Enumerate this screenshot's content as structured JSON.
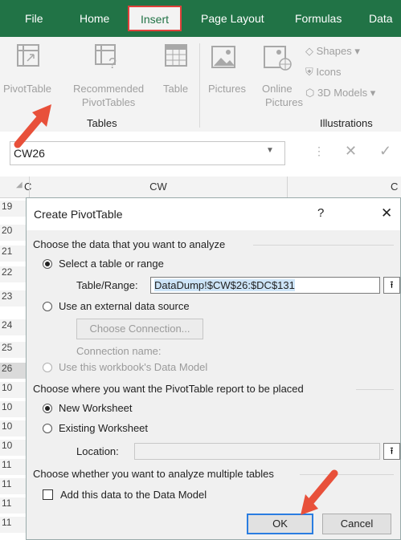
{
  "ribbon_tabs": [
    "File",
    "Home",
    "Insert",
    "Page Layout",
    "Formulas",
    "Data"
  ],
  "ribbon": {
    "pivottable": "PivotTable",
    "recommended_line1": "Recommended",
    "recommended_line2": "PivotTables",
    "table": "Table",
    "pictures": "Pictures",
    "online_line1": "Online",
    "online_line2": "Pictures",
    "shapes": "Shapes",
    "icons": "Icons",
    "models": "3D Models",
    "group_tables": "Tables",
    "group_illustrations": "Illustrations"
  },
  "namebox": "CW26",
  "grid": {
    "col_left": "C",
    "col_main": "CW",
    "col_right": "C",
    "rows": [
      "19",
      "20",
      "21",
      "22",
      "23",
      "24",
      "25",
      "26",
      "10",
      "10",
      "10",
      "10",
      "11",
      "11",
      "11",
      "11"
    ]
  },
  "dialog": {
    "title": "Create PivotTable",
    "help": "?",
    "close": "✕",
    "section1": "Choose the data that you want to analyze",
    "opt_select_table": "Select a table or range",
    "table_range_label": "Table/Range:",
    "table_range_value": "DataDump!$CW$26:$DC$131",
    "opt_external": "Use an external data source",
    "choose_connection": "Choose Connection...",
    "connection_name": "Connection name:",
    "opt_data_model": "Use this workbook's Data Model",
    "section2": "Choose where you want the PivotTable report to be placed",
    "opt_new_ws": "New Worksheet",
    "opt_existing_ws": "Existing Worksheet",
    "location_label": "Location:",
    "location_value": "",
    "section3": "Choose whether you want to analyze multiple tables",
    "add_data_model": "Add this data to the Data Model",
    "ok": "OK",
    "cancel": "Cancel"
  },
  "colors": {
    "ribbon_green": "#217346",
    "highlight_red": "#e0403a",
    "arrow_red": "#e8503a",
    "default_button_blue": "#2a7de1"
  }
}
